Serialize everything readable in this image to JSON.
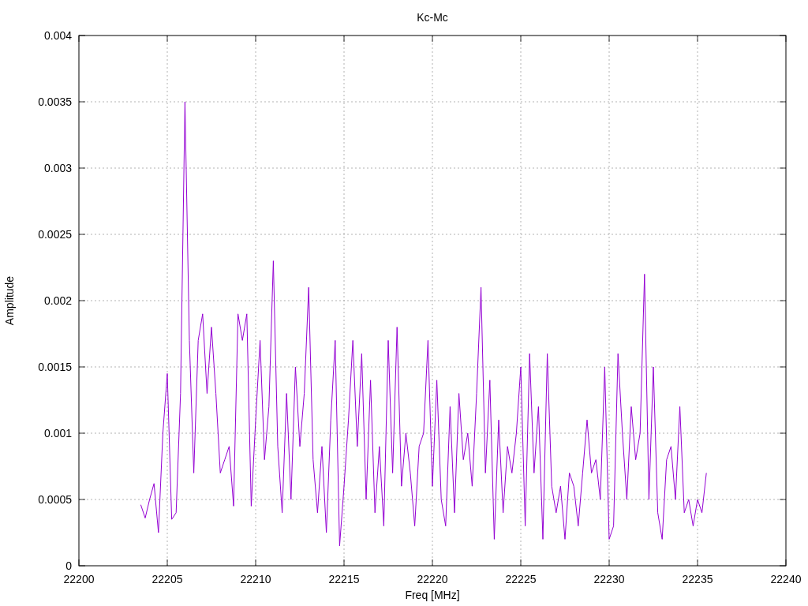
{
  "chart_data": {
    "type": "line",
    "grid": true,
    "title": "Kc-Mc",
    "xlabel": "Freq [MHz]",
    "ylabel": "Amplitude",
    "xlim": [
      22200,
      22240
    ],
    "ylim": [
      0,
      0.004
    ],
    "xticks": [
      22200,
      22205,
      22210,
      22215,
      22220,
      22225,
      22230,
      22235,
      22240
    ],
    "yticks": [
      0,
      0.0005,
      0.001,
      0.0015,
      0.002,
      0.0025,
      0.003,
      0.0035,
      0.004
    ],
    "x": [
      22203.5,
      22203.75,
      22204,
      22204.25,
      22204.5,
      22204.75,
      22205,
      22205.25,
      22205.5,
      22205.75,
      22206,
      22206.25,
      22206.5,
      22206.75,
      22207,
      22207.25,
      22207.5,
      22207.75,
      22208,
      22208.25,
      22208.5,
      22208.75,
      22209,
      22209.25,
      22209.5,
      22209.75,
      22210,
      22210.25,
      22210.5,
      22210.75,
      22211,
      22211.25,
      22211.5,
      22211.75,
      22212,
      22212.25,
      22212.5,
      22212.75,
      22213,
      22213.25,
      22213.5,
      22213.75,
      22214,
      22214.25,
      22214.5,
      22214.75,
      22215,
      22215.25,
      22215.5,
      22215.75,
      22216,
      22216.25,
      22216.5,
      22216.75,
      22217,
      22217.25,
      22217.5,
      22217.75,
      22218,
      22218.25,
      22218.5,
      22218.75,
      22219,
      22219.25,
      22219.5,
      22219.75,
      22220,
      22220.25,
      22220.5,
      22220.75,
      22221,
      22221.25,
      22221.5,
      22221.75,
      22222,
      22222.25,
      22222.5,
      22222.75,
      22223,
      22223.25,
      22223.5,
      22223.75,
      22224,
      22224.25,
      22224.5,
      22224.75,
      22225,
      22225.25,
      22225.5,
      22225.75,
      22226,
      22226.25,
      22226.5,
      22226.75,
      22227,
      22227.25,
      22227.5,
      22227.75,
      22228,
      22228.25,
      22228.5,
      22228.75,
      22229,
      22229.25,
      22229.5,
      22229.75,
      22230,
      22230.25,
      22230.5,
      22230.75,
      22231,
      22231.25,
      22231.5,
      22231.75,
      22232,
      22232.25,
      22232.5,
      22232.75,
      22233,
      22233.25,
      22233.5,
      22233.75,
      22234,
      22234.25,
      22234.5,
      22234.75,
      22235,
      22235.25,
      22235.5
    ],
    "series": [
      {
        "color": "#9400d3",
        "values": [
          0.00046,
          0.00036,
          0.0005,
          0.00062,
          0.00025,
          0.001,
          0.00145,
          0.00035,
          0.0004,
          0.0013,
          0.0035,
          0.0017,
          0.0007,
          0.0017,
          0.0019,
          0.0013,
          0.0018,
          0.0013,
          0.0007,
          0.0008,
          0.0009,
          0.00045,
          0.0019,
          0.0017,
          0.0019,
          0.00045,
          0.0011,
          0.0017,
          0.0008,
          0.0012,
          0.0023,
          0.0009,
          0.0004,
          0.0013,
          0.0005,
          0.0015,
          0.0009,
          0.0013,
          0.0021,
          0.0008,
          0.0004,
          0.0009,
          0.00025,
          0.0011,
          0.0017,
          0.00015,
          0.0006,
          0.0011,
          0.0017,
          0.0009,
          0.0016,
          0.0005,
          0.0014,
          0.0004,
          0.0009,
          0.0003,
          0.0017,
          0.0007,
          0.0018,
          0.0006,
          0.001,
          0.0007,
          0.0003,
          0.0009,
          0.001,
          0.0017,
          0.0006,
          0.0014,
          0.0005,
          0.0003,
          0.0012,
          0.0004,
          0.0013,
          0.0008,
          0.001,
          0.0006,
          0.0013,
          0.0021,
          0.0007,
          0.0014,
          0.0002,
          0.0011,
          0.0004,
          0.0009,
          0.0007,
          0.001,
          0.0015,
          0.0003,
          0.0016,
          0.0007,
          0.0012,
          0.0002,
          0.0016,
          0.0006,
          0.0004,
          0.0006,
          0.0002,
          0.0007,
          0.0006,
          0.0003,
          0.0007,
          0.0011,
          0.0007,
          0.0008,
          0.0005,
          0.0015,
          0.0002,
          0.0003,
          0.0016,
          0.001,
          0.0005,
          0.0012,
          0.0008,
          0.001,
          0.0022,
          0.0005,
          0.0015,
          0.0004,
          0.0002,
          0.0008,
          0.0009,
          0.0005,
          0.0012,
          0.0004,
          0.0005,
          0.0003,
          0.0005,
          0.0004,
          0.0007
        ]
      }
    ]
  }
}
